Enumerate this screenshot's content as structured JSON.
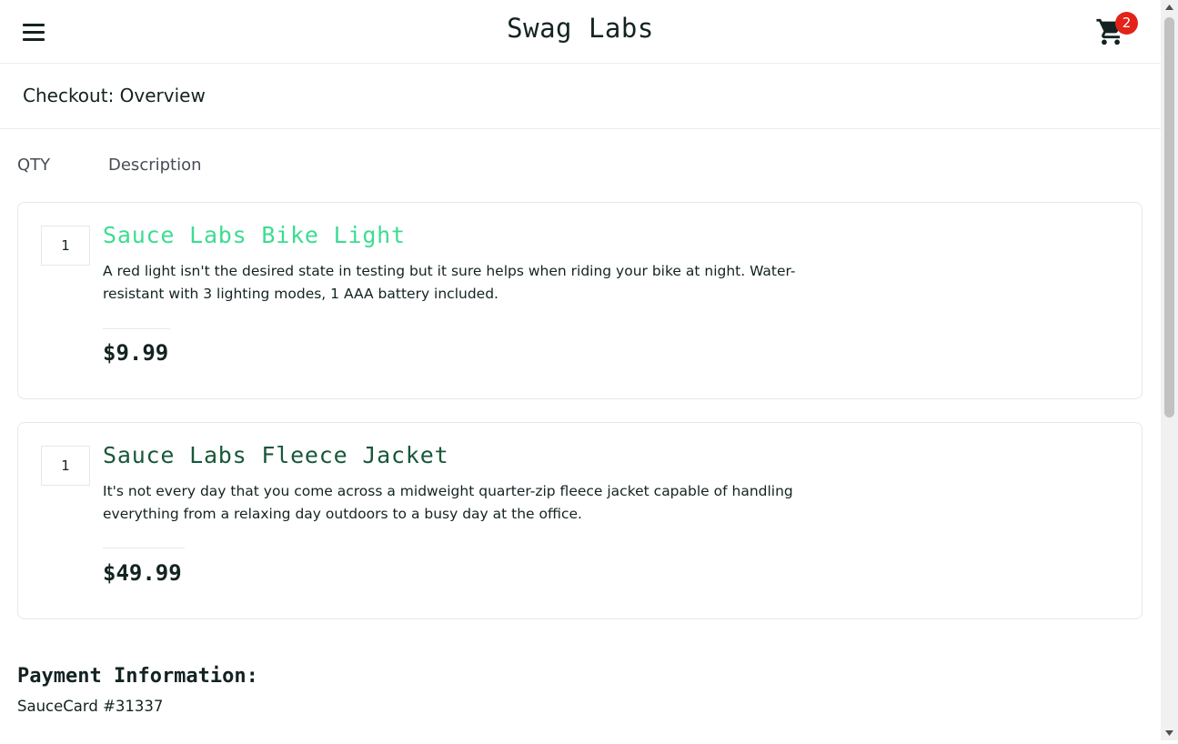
{
  "header": {
    "logo": "Swag Labs",
    "menu_icon": "hamburger-menu-icon",
    "cart_icon": "shopping-cart-icon",
    "cart_count": "2",
    "badge_color": "#e2231a"
  },
  "page_title": "Checkout: Overview",
  "list_header": {
    "qty": "QTY",
    "description": "Description"
  },
  "items": [
    {
      "qty": "1",
      "name": "Sauce Labs Bike Light",
      "description": "A red light isn't the desired state in testing but it sure helps when riding your bike at night. Water-resistant with 3 lighting modes, 1 AAA battery included.",
      "price": "$9.99",
      "name_color": "#3ddc91"
    },
    {
      "qty": "1",
      "name": "Sauce Labs Fleece Jacket",
      "description": "It's not every day that you come across a midweight quarter-zip fleece jacket capable of handling everything from a relaxing day outdoors to a busy day at the office.",
      "price": "$49.99",
      "name_color": "#18583a"
    }
  ],
  "summary": {
    "payment_label": "Payment Information:",
    "payment_value": "SauceCard #31337"
  }
}
